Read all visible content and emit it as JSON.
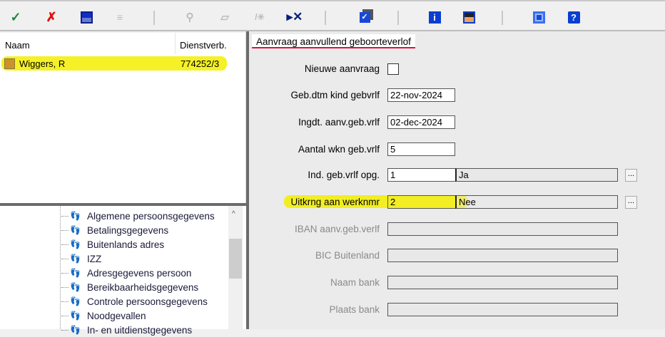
{
  "toolbar": {
    "icons": [
      "check-icon",
      "cancel-icon",
      "save-icon",
      "edit-icon",
      "tool-icon",
      "eraser-icon",
      "wand-icon",
      "delete-record-icon",
      "checklist-icon",
      "info-icon",
      "person-icon",
      "window-icon",
      "help-icon"
    ]
  },
  "list": {
    "columns": [
      "Naam",
      "Dienstverb."
    ],
    "rows": [
      {
        "name": "Wiggers, R",
        "dienstverband": "774252/3"
      }
    ]
  },
  "tree": {
    "items": [
      "Algemene persoonsgegevens",
      "Betalingsgegevens",
      "Buitenlands adres",
      "IZZ",
      "Adresgegevens persoon",
      "Bereikbaarheidsgegevens",
      "Controle persoonsgegevens",
      "Noodgevallen",
      "In- en uitdienstgegevens"
    ]
  },
  "form": {
    "tab": "Aanvraag aanvullend geboorteverlof",
    "nieuwe_aanvraag": {
      "label": "Nieuwe aanvraag",
      "checked": false
    },
    "geb_dtm": {
      "label": "Geb.dtm kind gebvrlf",
      "value": "22-nov-2024"
    },
    "ingdt": {
      "label": "Ingdt. aanv.geb.vrlf",
      "value": "02-dec-2024"
    },
    "aantal": {
      "label": "Aantal wkn geb.vrlf",
      "value": "5"
    },
    "ind": {
      "label": "Ind. geb.vrlf opg.",
      "code": "1",
      "desc": "Ja",
      "button": "..."
    },
    "uitk": {
      "label": "Uitkrng aan werknmr",
      "code": "2",
      "desc": "Nee",
      "button": "..."
    },
    "iban": {
      "label": "IBAN aanv.geb.verlf",
      "value": ""
    },
    "bic": {
      "label": "BIC Buitenland",
      "value": ""
    },
    "naam_bank": {
      "label": "Naam bank",
      "value": ""
    },
    "plaats_bank": {
      "label": "Plaats bank",
      "value": ""
    }
  },
  "colors": {
    "highlight": "#f3ee00",
    "tab_underline": "#e0103c"
  }
}
